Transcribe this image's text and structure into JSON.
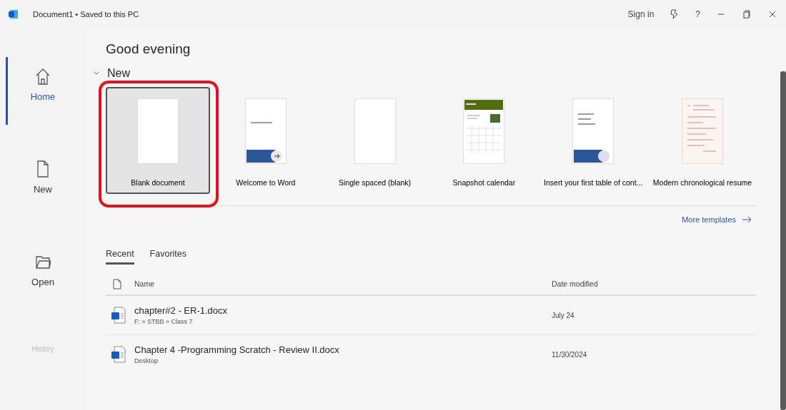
{
  "window": {
    "title": "Document1 • Saved to this PC",
    "sign_in": "Sign in",
    "help": "?"
  },
  "sidebar": {
    "items": [
      {
        "label": "Home",
        "selected": true,
        "disabled": false
      },
      {
        "label": "New",
        "selected": false,
        "disabled": false
      },
      {
        "label": "Open",
        "selected": false,
        "disabled": false
      },
      {
        "label": "History",
        "selected": false,
        "disabled": true
      }
    ]
  },
  "greeting": "Good evening",
  "new_section": {
    "title": "New",
    "expanded": true,
    "templates": [
      {
        "label": "Blank document",
        "kind": "blank",
        "selected": true
      },
      {
        "label": "Welcome to Word",
        "kind": "tour",
        "selected": false
      },
      {
        "label": "Single spaced (blank)",
        "kind": "blank",
        "selected": false
      },
      {
        "label": "Snapshot calendar",
        "kind": "calendar",
        "selected": false
      },
      {
        "label": "Insert your first table of cont...",
        "kind": "toc",
        "selected": false
      },
      {
        "label": "Modern chronological resume",
        "kind": "resume",
        "selected": false
      }
    ],
    "more_templates": "More templates"
  },
  "recent_tabs": [
    {
      "label": "Recent",
      "selected": true
    },
    {
      "label": "Favorites",
      "selected": false
    }
  ],
  "files": {
    "columns": [
      "Name",
      "Date modified"
    ],
    "rows": [
      {
        "name": "chapter#2 - ER-1.docx",
        "location": "F: » STBB » Class 7",
        "date": "July 24"
      },
      {
        "name": "Chapter 4 -Programming Scratch - Review II.docx",
        "location": "Desktop",
        "date": "11/30/2024"
      }
    ]
  }
}
